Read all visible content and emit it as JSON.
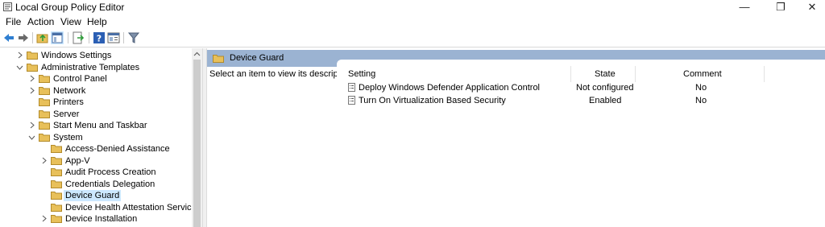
{
  "window": {
    "title": "Local Group Policy Editor",
    "controls": {
      "minimize": "—",
      "restore": "❐",
      "close": "✕"
    }
  },
  "menu": [
    "File",
    "Action",
    "View",
    "Help"
  ],
  "toolbar": {
    "icons": [
      "back-arrow-icon",
      "forward-arrow-icon",
      "up-folder-icon",
      "show-hide-tree-icon",
      "export-list-icon",
      "help-icon",
      "properties-icon",
      "filter-icon"
    ]
  },
  "tree": {
    "items": [
      {
        "label": "Windows Settings",
        "level": 1,
        "expander": "collapsed"
      },
      {
        "label": "Administrative Templates",
        "level": 1,
        "expander": "expanded"
      },
      {
        "label": "Control Panel",
        "level": 2,
        "expander": "collapsed"
      },
      {
        "label": "Network",
        "level": 2,
        "expander": "collapsed"
      },
      {
        "label": "Printers",
        "level": 2,
        "expander": "none"
      },
      {
        "label": "Server",
        "level": 2,
        "expander": "none"
      },
      {
        "label": "Start Menu and Taskbar",
        "level": 2,
        "expander": "collapsed"
      },
      {
        "label": "System",
        "level": 2,
        "expander": "expanded"
      },
      {
        "label": "Access-Denied Assistance",
        "level": 3,
        "expander": "none"
      },
      {
        "label": "App-V",
        "level": 3,
        "expander": "collapsed"
      },
      {
        "label": "Audit Process Creation",
        "level": 3,
        "expander": "none"
      },
      {
        "label": "Credentials Delegation",
        "level": 3,
        "expander": "none"
      },
      {
        "label": "Device Guard",
        "level": 3,
        "expander": "none",
        "selected": true
      },
      {
        "label": "Device Health Attestation Service",
        "level": 3,
        "expander": "none"
      },
      {
        "label": "Device Installation",
        "level": 3,
        "expander": "collapsed"
      }
    ]
  },
  "right_pane": {
    "title": "Device Guard",
    "description": "Select an item to view its description.",
    "columns": {
      "setting": "Setting",
      "state": "State",
      "comment": "Comment"
    },
    "rows": [
      {
        "setting": "Deploy Windows Defender Application Control",
        "state": "Not configured",
        "comment": "No"
      },
      {
        "setting": "Turn On Virtualization Based Security",
        "state": "Enabled",
        "comment": "No"
      }
    ]
  },
  "colors": {
    "header_band": "#9bb3d2",
    "selection": "#cce8ff",
    "folder": "#e8c05a"
  }
}
